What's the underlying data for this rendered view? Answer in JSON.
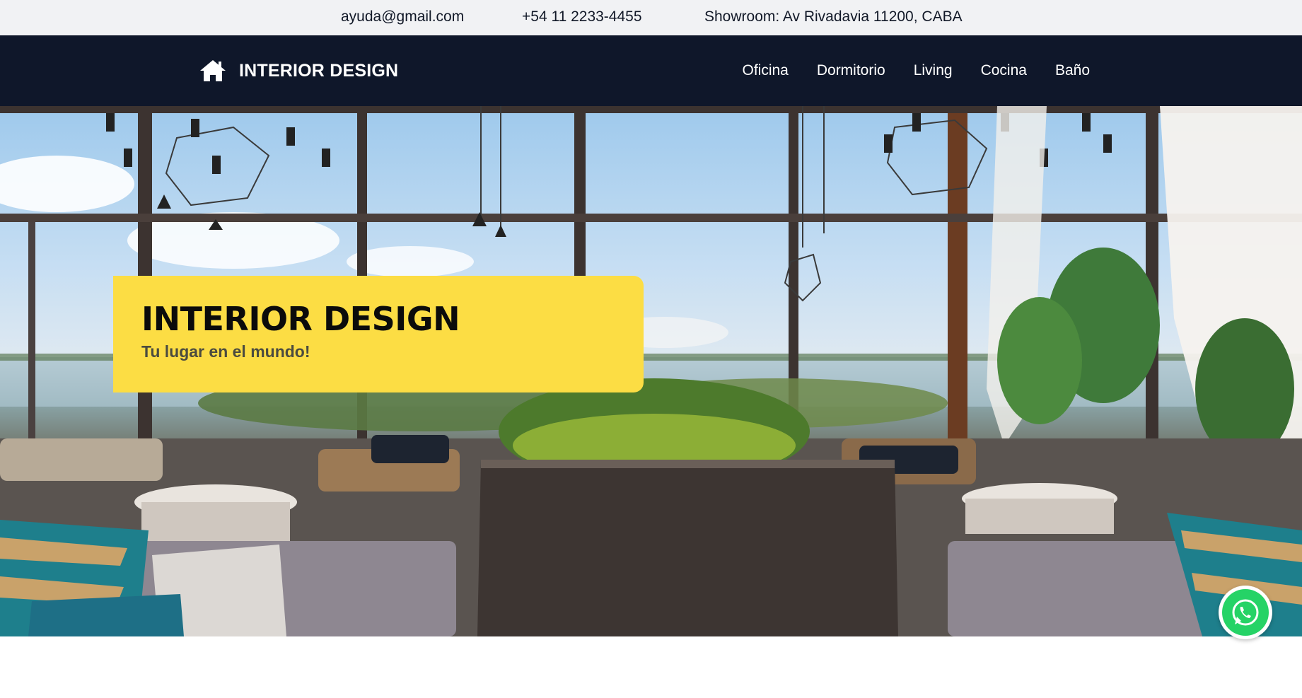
{
  "topbar": {
    "email": "ayuda@gmail.com",
    "phone": "+54 11 2233-4455",
    "showroom": "Showroom: Av Rivadavia 11200, CABA"
  },
  "navbar": {
    "brand_icon": "home-icon",
    "brand": "INTERIOR DESIGN",
    "links": [
      "Oficina",
      "Dormitorio",
      "Living",
      "Cocina",
      "Baño"
    ]
  },
  "hero": {
    "title": "INTERIOR DESIGN",
    "subtitle": "Tu lugar en el mundo!"
  },
  "floating": {
    "whatsapp_icon": "whatsapp-icon"
  },
  "colors": {
    "topbar_bg": "#f1f2f4",
    "navbar_bg": "#0f172a",
    "accent_yellow": "#fcdd44",
    "whatsapp_green": "#25d366"
  }
}
